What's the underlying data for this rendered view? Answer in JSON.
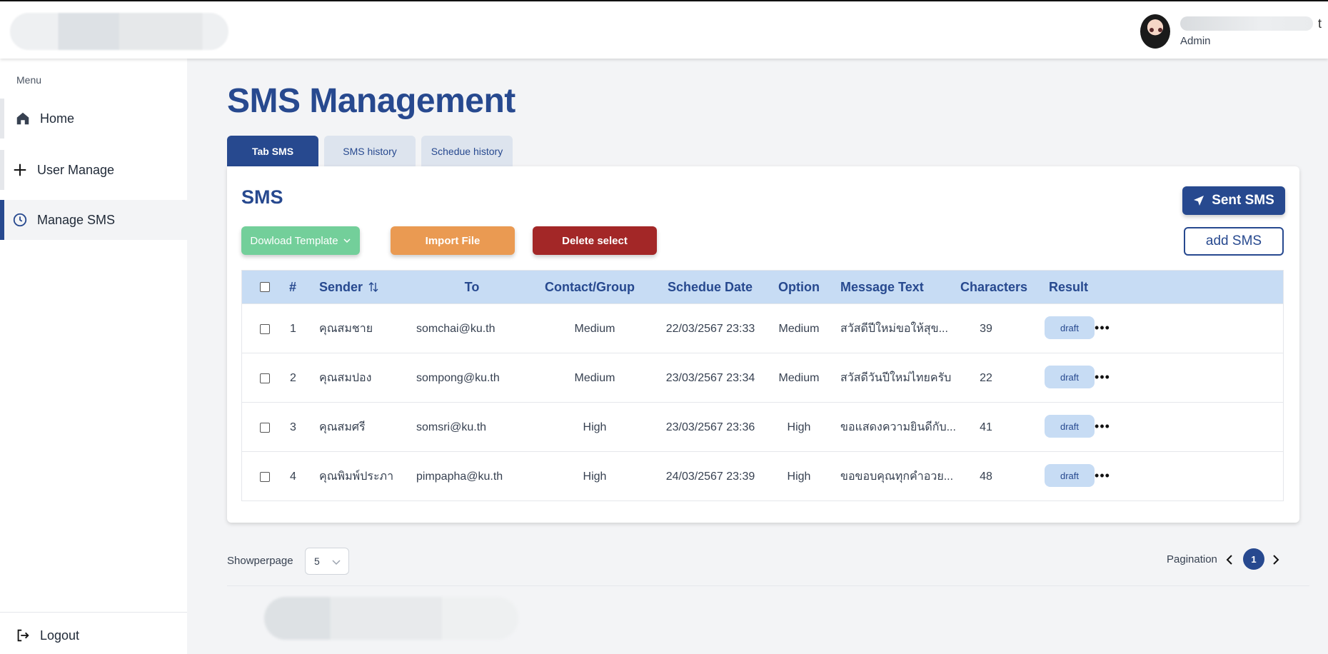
{
  "header": {
    "user_role": "Admin",
    "user_name_tail": "t"
  },
  "sidebar": {
    "menu_label": "Menu",
    "items": [
      {
        "label": "Home",
        "icon": "home-icon"
      },
      {
        "label": "User Manage",
        "icon": "plus-icon"
      },
      {
        "label": "Manage SMS",
        "icon": "clock-icon",
        "active": true
      }
    ],
    "logout_label": "Logout"
  },
  "main": {
    "title": "SMS Management",
    "tabs": [
      {
        "label": "Tab SMS",
        "active": true
      },
      {
        "label": "SMS history",
        "active": false
      },
      {
        "label": "Schedue history",
        "active": false
      }
    ],
    "card_title": "SMS",
    "buttons": {
      "download_template": "Dowload Template",
      "import_file": "Import File",
      "delete_select": "Delete select",
      "sent_sms": "Sent SMS",
      "add_sms": "add SMS"
    },
    "table": {
      "headers": {
        "index": "#",
        "sender": "Sender",
        "to": "To",
        "contact_group": "Contact/Group",
        "schedule_date": "Schedue Date",
        "option": "Option",
        "message_text": "Message Text",
        "characters": "Characters",
        "result": "Result"
      },
      "rows": [
        {
          "index": "1",
          "sender": "คุณสมชาย",
          "to": "somchai@ku.th",
          "contact_group": "Medium",
          "schedule_date": "22/03/2567 23:33",
          "option": "Medium",
          "message_text": "สวัสดีปีใหม่ขอให้สุข...",
          "characters": "39",
          "result": "draft"
        },
        {
          "index": "2",
          "sender": "คุณสมปอง",
          "to": "sompong@ku.th",
          "contact_group": "Medium",
          "schedule_date": "23/03/2567 23:34",
          "option": "Medium",
          "message_text": "สวัสดีวันปีใหม่ไทยครับ",
          "characters": "22",
          "result": "draft"
        },
        {
          "index": "3",
          "sender": "คุณสมศรี",
          "to": "somsri@ku.th",
          "contact_group": "High",
          "schedule_date": "23/03/2567 23:36",
          "option": "High",
          "message_text": "ขอแสดงความยินดีกับ...",
          "characters": "41",
          "result": "draft"
        },
        {
          "index": "4",
          "sender": "คุณพิมพ์ประภา",
          "to": "pimpapha@ku.th",
          "contact_group": "High",
          "schedule_date": "24/03/2567 23:39",
          "option": "High",
          "message_text": "ขอขอบคุณทุกคำอวย...",
          "characters": "48",
          "result": "draft"
        }
      ]
    },
    "per_page": {
      "label": "Showperpage",
      "value": "5"
    },
    "pagination": {
      "label": "Pagination",
      "current": "1"
    }
  },
  "colors": {
    "primary": "#27498f",
    "header_row": "#c7dcf4",
    "template_button": "#73cf9a",
    "import_button": "#ea9a52",
    "delete_button": "#a32727"
  }
}
